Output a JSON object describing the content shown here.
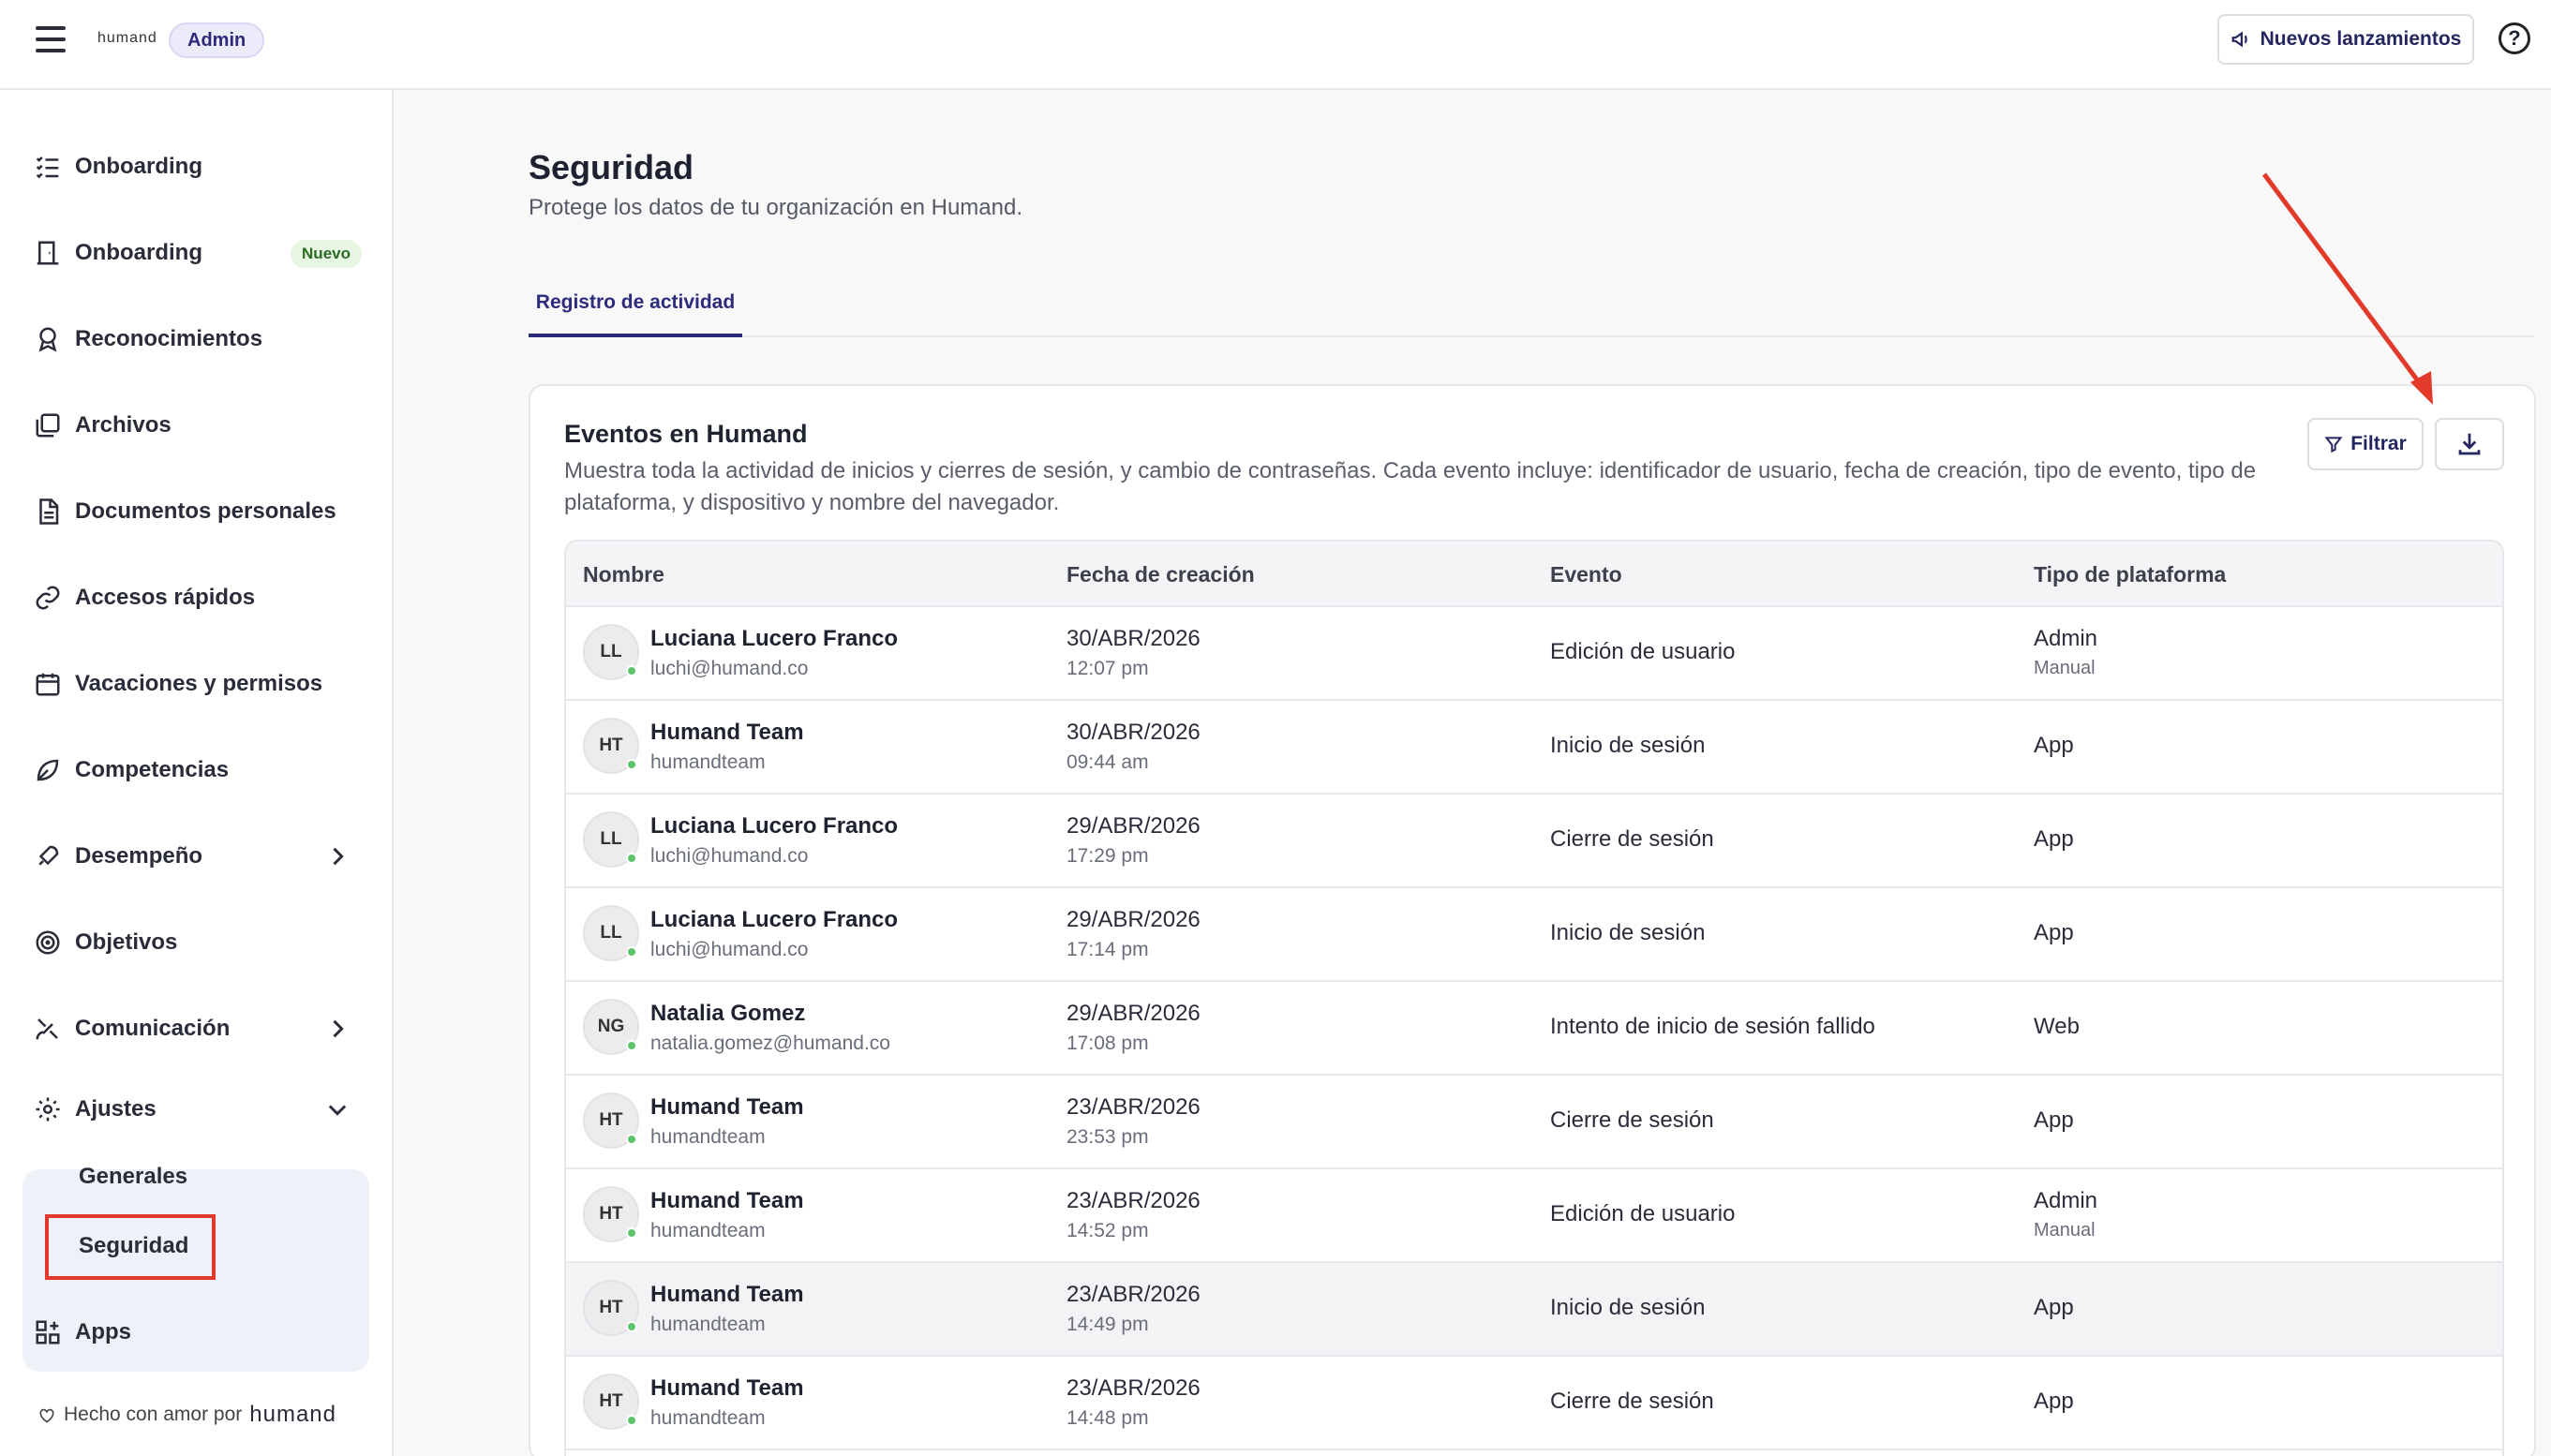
{
  "topbar": {
    "logo": "humand",
    "badge": "Admin",
    "releases_label": "Nuevos lanzamientos",
    "help": "?"
  },
  "sidebar": {
    "items": [
      {
        "label": "Onboarding",
        "icon": "checklist-icon"
      },
      {
        "label": "Onboarding",
        "icon": "door-icon",
        "badge": "Nuevo"
      },
      {
        "label": "Reconocimientos",
        "icon": "award-icon"
      },
      {
        "label": "Archivos",
        "icon": "folders-icon"
      },
      {
        "label": "Documentos personales",
        "icon": "document-icon"
      },
      {
        "label": "Accesos rápidos",
        "icon": "link-icon"
      },
      {
        "label": "Vacaciones y permisos",
        "icon": "calendar-icon"
      },
      {
        "label": "Competencias",
        "icon": "leaf-icon"
      },
      {
        "label": "Desempeño",
        "icon": "rocket-icon"
      },
      {
        "label": "Objetivos",
        "icon": "target-icon"
      },
      {
        "label": "Comunicación",
        "icon": "satellite-icon"
      }
    ],
    "ajustes": {
      "label": "Ajustes",
      "sub": [
        "Generales",
        "Seguridad"
      ]
    },
    "apps_label": "Apps",
    "footer": {
      "text": "Hecho con amor por",
      "brand": "humand"
    }
  },
  "main": {
    "title": "Seguridad",
    "subtitle": "Protege los datos de tu organización en Humand.",
    "tabs": [
      "Registro de actividad"
    ],
    "card": {
      "title": "Eventos en Humand",
      "description": "Muestra toda la actividad de inicios y cierres de sesión, y cambio de contraseñas. Cada evento incluye: identificador de usuario, fecha de creación, tipo de evento, tipo de plataforma, y dispositivo y nombre del navegador.",
      "filter_label": "Filtrar"
    },
    "table": {
      "headers": [
        "Nombre",
        "Fecha de creación",
        "Evento",
        "Tipo de plataforma"
      ],
      "rows": [
        {
          "initials": "LL",
          "name": "Luciana Lucero Franco",
          "sub": "luchi@humand.co",
          "date": "30/ABR/2026",
          "time": "12:07 pm",
          "event": "Edición de usuario",
          "platform": "Admin",
          "platform_sub": "Manual"
        },
        {
          "initials": "HT",
          "name": "Humand Team",
          "sub": "humandteam",
          "date": "30/ABR/2026",
          "time": "09:44 am",
          "event": "Inicio de sesión",
          "platform": "App",
          "platform_sub": ""
        },
        {
          "initials": "LL",
          "name": "Luciana Lucero Franco",
          "sub": "luchi@humand.co",
          "date": "29/ABR/2026",
          "time": "17:29 pm",
          "event": "Cierre de sesión",
          "platform": "App",
          "platform_sub": ""
        },
        {
          "initials": "LL",
          "name": "Luciana Lucero Franco",
          "sub": "luchi@humand.co",
          "date": "29/ABR/2026",
          "time": "17:14 pm",
          "event": "Inicio de sesión",
          "platform": "App",
          "platform_sub": ""
        },
        {
          "initials": "NG",
          "name": "Natalia Gomez",
          "sub": "natalia.gomez@humand.co",
          "date": "29/ABR/2026",
          "time": "17:08 pm",
          "event": "Intento de inicio de sesión fallido",
          "platform": "Web",
          "platform_sub": ""
        },
        {
          "initials": "HT",
          "name": "Humand Team",
          "sub": "humandteam",
          "date": "23/ABR/2026",
          "time": "23:53 pm",
          "event": "Cierre de sesión",
          "platform": "App",
          "platform_sub": ""
        },
        {
          "initials": "HT",
          "name": "Humand Team",
          "sub": "humandteam",
          "date": "23/ABR/2026",
          "time": "14:52 pm",
          "event": "Edición de usuario",
          "platform": "Admin",
          "platform_sub": "Manual"
        },
        {
          "initials": "HT",
          "name": "Humand Team",
          "sub": "humandteam",
          "date": "23/ABR/2026",
          "time": "14:49 pm",
          "event": "Inicio de sesión",
          "platform": "App",
          "platform_sub": ""
        },
        {
          "initials": "HT",
          "name": "Humand Team",
          "sub": "humandteam",
          "date": "23/ABR/2026",
          "time": "14:48 pm",
          "event": "Cierre de sesión",
          "platform": "App",
          "platform_sub": ""
        }
      ]
    }
  },
  "colors": {
    "accent": "#2d2b7b",
    "annotation": "#e13a2a",
    "online": "#5cc56a"
  }
}
